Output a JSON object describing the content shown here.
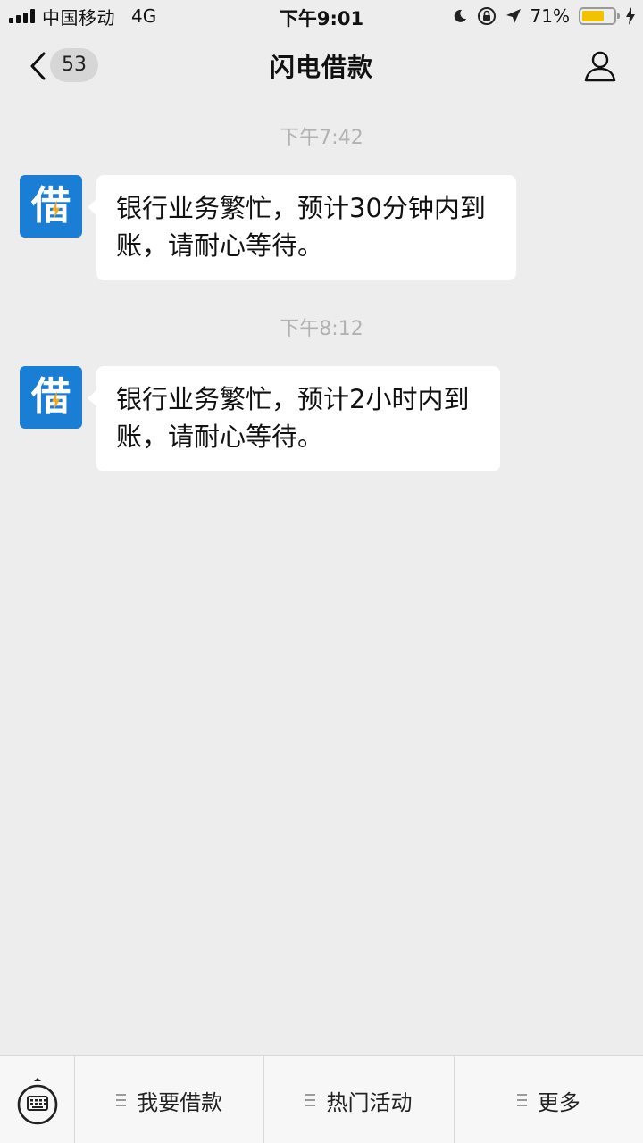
{
  "status_bar": {
    "carrier": "中国移动",
    "network": "4G",
    "time": "下午9:01",
    "battery_percent": "71%",
    "battery_level": 0.71,
    "icons": [
      "signal-icon",
      "moon-icon",
      "rotation-lock-icon",
      "location-arrow-icon",
      "battery-icon",
      "charging-bolt-icon"
    ]
  },
  "nav": {
    "back_badge": "53",
    "title": "闪电借款",
    "icons": [
      "back-chevron-icon",
      "person-icon"
    ]
  },
  "messages": [
    {
      "timestamp": "下午7:42",
      "avatar_char": "借",
      "text_line1": "银行业务繁忙，预计30分钟内到",
      "text_line2": "账，请耐心等待。"
    },
    {
      "timestamp": "下午8:12",
      "avatar_char": "借",
      "text_line1": "银行业务繁忙，预计2小时内到",
      "text_line2": "账，请耐心等待。"
    }
  ],
  "bottom_menu": {
    "items": [
      {
        "label": "我要借款"
      },
      {
        "label": "热门活动"
      },
      {
        "label": "更多"
      }
    ],
    "icons": [
      "keyboard-icon",
      "menu-lines-icon"
    ]
  },
  "colors": {
    "background": "#ededed",
    "avatar_blue": "#1a7fd4",
    "bubble": "#ffffff",
    "timestamp": "#b2b2b2",
    "battery_fill": "#f2c200"
  }
}
